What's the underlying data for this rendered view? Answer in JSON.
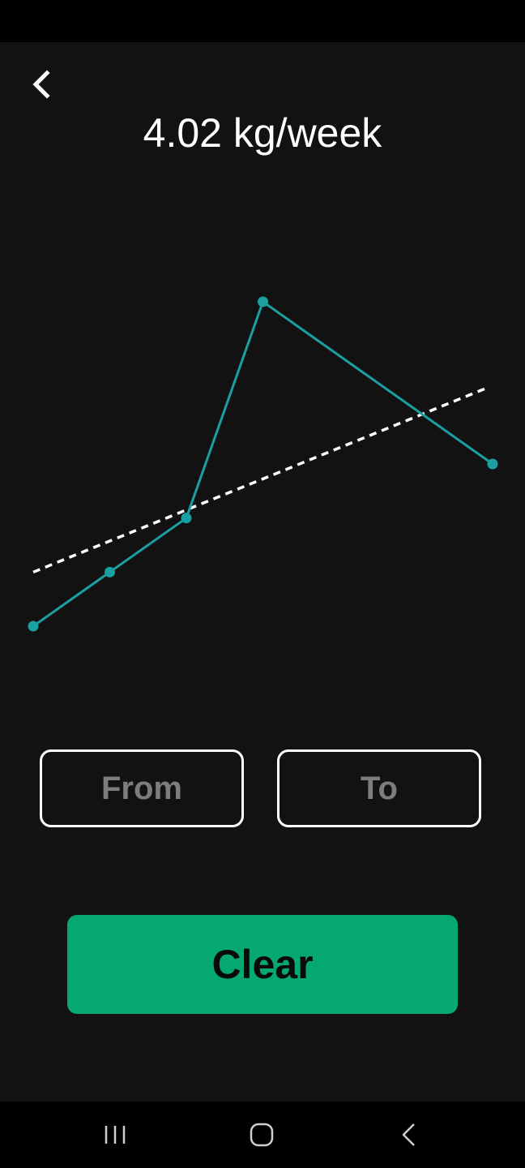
{
  "header": {
    "title": "4.02 kg/week",
    "back_icon": "chevron-left-icon"
  },
  "chart_data": {
    "type": "line",
    "x": [
      1,
      2,
      3,
      4,
      5,
      6,
      7
    ],
    "series": [
      {
        "values": [
          0.0,
          1.0,
          2.0,
          6.0,
          null,
          null,
          3.0
        ]
      }
    ],
    "trendline": {
      "start": 1.0,
      "end": 4.4
    },
    "ylim": [
      -1.5,
      7.8
    ],
    "xlim": [
      1,
      7
    ],
    "grid": false,
    "colors": {
      "line": "#1aa0a0",
      "trend": "#ffffff"
    }
  },
  "range": {
    "from_label": "From",
    "to_label": "To"
  },
  "actions": {
    "clear_label": "Clear"
  },
  "colors": {
    "background": "#121212",
    "accent": "#05a96f",
    "line": "#1aa0a0"
  },
  "nav": {
    "recents_icon": "recents-icon",
    "home_icon": "home-icon",
    "back_icon": "back-icon"
  }
}
